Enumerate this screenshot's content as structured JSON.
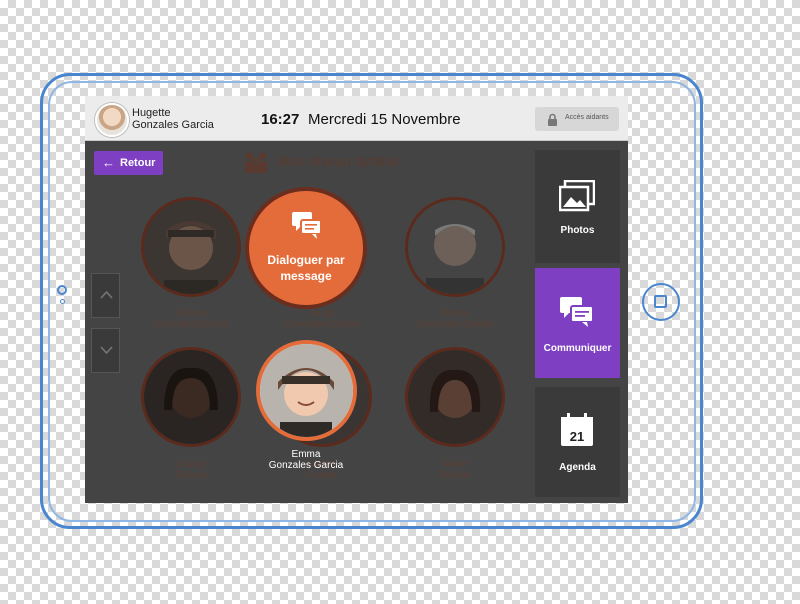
{
  "header": {
    "user_first": "Hugette",
    "user_last": "Gonzales Garcia",
    "time": "16:27",
    "date": "Mercredi 15 Novembre",
    "access_label": "Accès aidants"
  },
  "page": {
    "back_label": "Retour",
    "title": "Mon réseau familial"
  },
  "action_popup": {
    "line1": "Dialoguer par",
    "line2": "message"
  },
  "contacts": [
    {
      "first": "Emma",
      "last": "Gonzales Garcia"
    },
    {
      "first": "Hugo",
      "last": "Gonzales Garcia"
    },
    {
      "first": "Pierre",
      "last": "Gonzales Garcia"
    },
    {
      "first": "Louise",
      "last": "Dubois"
    },
    {
      "first": "Louise",
      "last": "Dubois"
    },
    {
      "first": "Marie",
      "last": "Dubois"
    }
  ],
  "selected_contact": {
    "first": "Emma",
    "last": "Gonzales Garcia"
  },
  "sidebar": {
    "items": [
      {
        "label": "Photos",
        "icon": "photos-icon"
      },
      {
        "label": "Communiquer",
        "icon": "chat-icon",
        "active": true
      },
      {
        "label": "Agenda",
        "icon": "calendar-icon",
        "day": "21"
      }
    ]
  },
  "colors": {
    "accent_purple": "#7e3fc2",
    "accent_orange": "#e46c3a",
    "frame_blue": "#4a86d0",
    "screen_bg": "#444444"
  }
}
